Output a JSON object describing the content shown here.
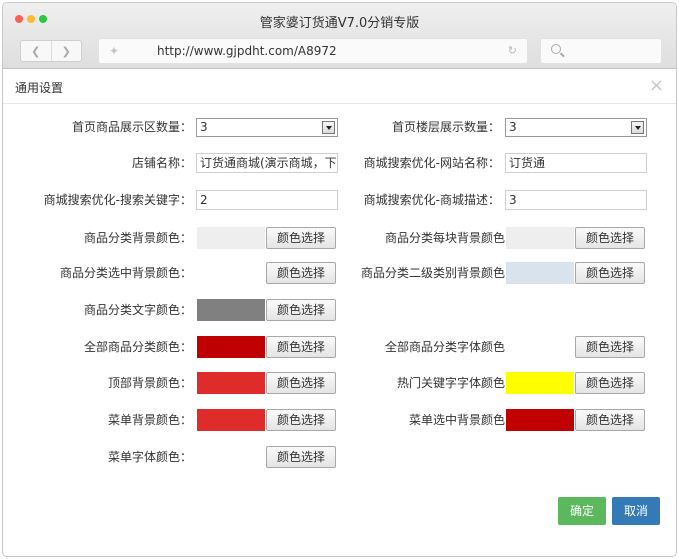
{
  "browser": {
    "title": "管家婆订货通V7.0分销专版",
    "url": "http://www.gjpdht.com/A8972",
    "dots": [
      "#ff5f57",
      "#febc2e",
      "#28c840"
    ]
  },
  "dialog": {
    "title": "通用设置",
    "close": "×"
  },
  "form": {
    "home_product_count": {
      "label": "首页商品展示区数量：",
      "value": "3"
    },
    "home_floor_count": {
      "label": "首页楼层展示数量：",
      "value": "3"
    },
    "shop_name": {
      "label": "店铺名称：",
      "value": "订货通商城(演示商城，下"
    },
    "seo_site_name": {
      "label": "商城搜索优化-网站名称：",
      "value": "订货通"
    },
    "seo_keywords": {
      "label": "商城搜索优化-搜索关键字：",
      "value": "2"
    },
    "seo_description": {
      "label": "商城搜索优化-商城描述：",
      "value": "3"
    },
    "color_button_label": "颜色选择",
    "colors": {
      "category_bg": {
        "label": "商品分类背景颜色：",
        "color": "#eeeeee"
      },
      "category_block_bg": {
        "label": "商品分类每块背景颜色",
        "color": "#eeeeee"
      },
      "category_selected_bg": {
        "label": "商品分类选中背景颜色：",
        "color": ""
      },
      "category_level2_bg": {
        "label": "商品分类二级类别背景颜色",
        "color": "#d9e3ed"
      },
      "category_text": {
        "label": "商品分类文字颜色：",
        "color": "#808080"
      },
      "all_category": {
        "label": "全部商品分类颜色：",
        "color": "#c00000"
      },
      "all_category_font": {
        "label": "全部商品分类字体颜色",
        "color": ""
      },
      "top_bg": {
        "label": "顶部背景颜色：",
        "color": "#e02b2b"
      },
      "hot_keyword_font": {
        "label": "热门关键字字体颜色",
        "color": "#ffff00"
      },
      "menu_bg": {
        "label": "菜单背景颜色：",
        "color": "#e02b2b"
      },
      "menu_selected_bg": {
        "label": "菜单选中背景颜色",
        "color": "#c00000"
      },
      "menu_font": {
        "label": "菜单字体颜色：",
        "color": ""
      }
    }
  },
  "actions": {
    "ok": "确定",
    "cancel": "取消"
  }
}
